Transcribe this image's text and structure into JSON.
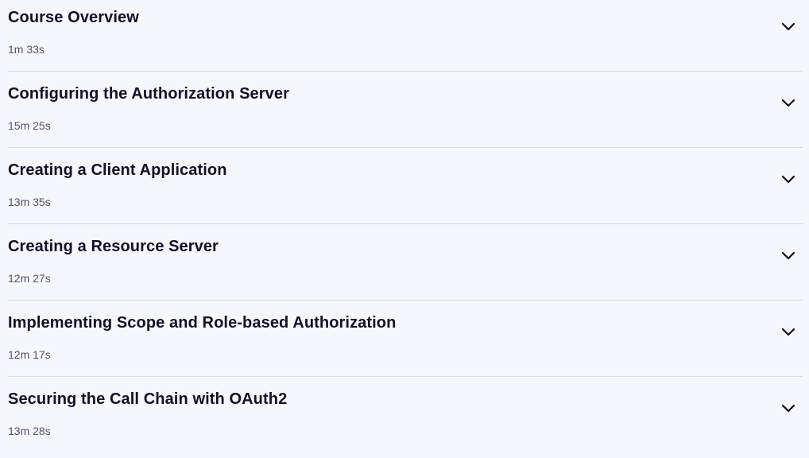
{
  "modules": [
    {
      "title": "Course Overview",
      "duration": "1m 33s",
      "icon": "chevron-down-icon"
    },
    {
      "title": "Configuring the Authorization Server",
      "duration": "15m 25s",
      "icon": "chevron-down-icon"
    },
    {
      "title": "Creating a Client Application",
      "duration": "13m 35s",
      "icon": "chevron-down-icon"
    },
    {
      "title": "Creating a Resource Server",
      "duration": "12m 27s",
      "icon": "chevron-down-icon"
    },
    {
      "title": "Implementing Scope and Role-based Authorization",
      "duration": "12m 17s",
      "icon": "chevron-down-icon"
    },
    {
      "title": "Securing the Call Chain with OAuth2",
      "duration": "13m 28s",
      "icon": "chevron-down-icon"
    }
  ],
  "colors": {
    "background": "#f4f7fb",
    "title_text": "#130f25",
    "duration_text": "#55526b",
    "divider": "#d8dde4"
  }
}
